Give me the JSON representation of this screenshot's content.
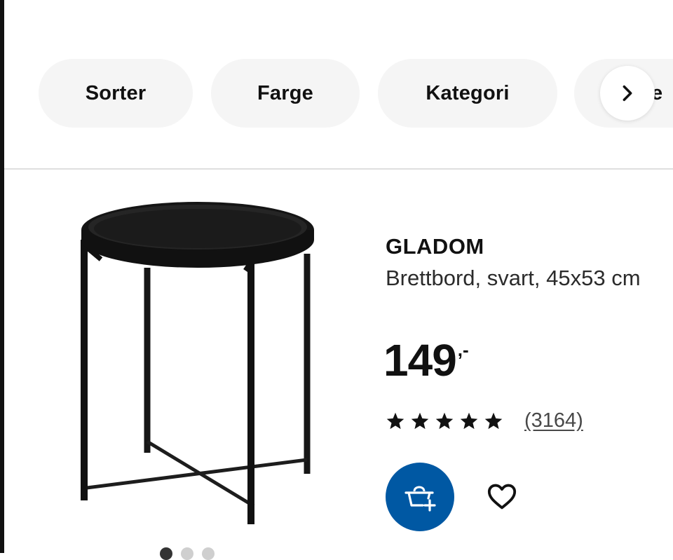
{
  "filters": {
    "chips": [
      {
        "label": "Sorter"
      },
      {
        "label": "Farge"
      },
      {
        "label": "Kategori"
      },
      {
        "label": "e"
      }
    ],
    "next_icon": "chevron-right-icon"
  },
  "product": {
    "name": "GLADOM",
    "description": "Brettbord, svart, 45x53 cm",
    "price": {
      "value": "149",
      "suffix": ",-"
    },
    "rating": {
      "stars": 5,
      "max": 5,
      "count_label": "(3164)"
    },
    "image_carousel": {
      "pages": 3,
      "active_index": 0
    },
    "actions": {
      "add_to_cart_icon": "shopping-bag-add-icon",
      "favourite_icon": "heart-icon"
    }
  },
  "colors": {
    "brand_blue": "#0058a3",
    "chip_background": "#f5f5f5",
    "text": "#111111"
  }
}
